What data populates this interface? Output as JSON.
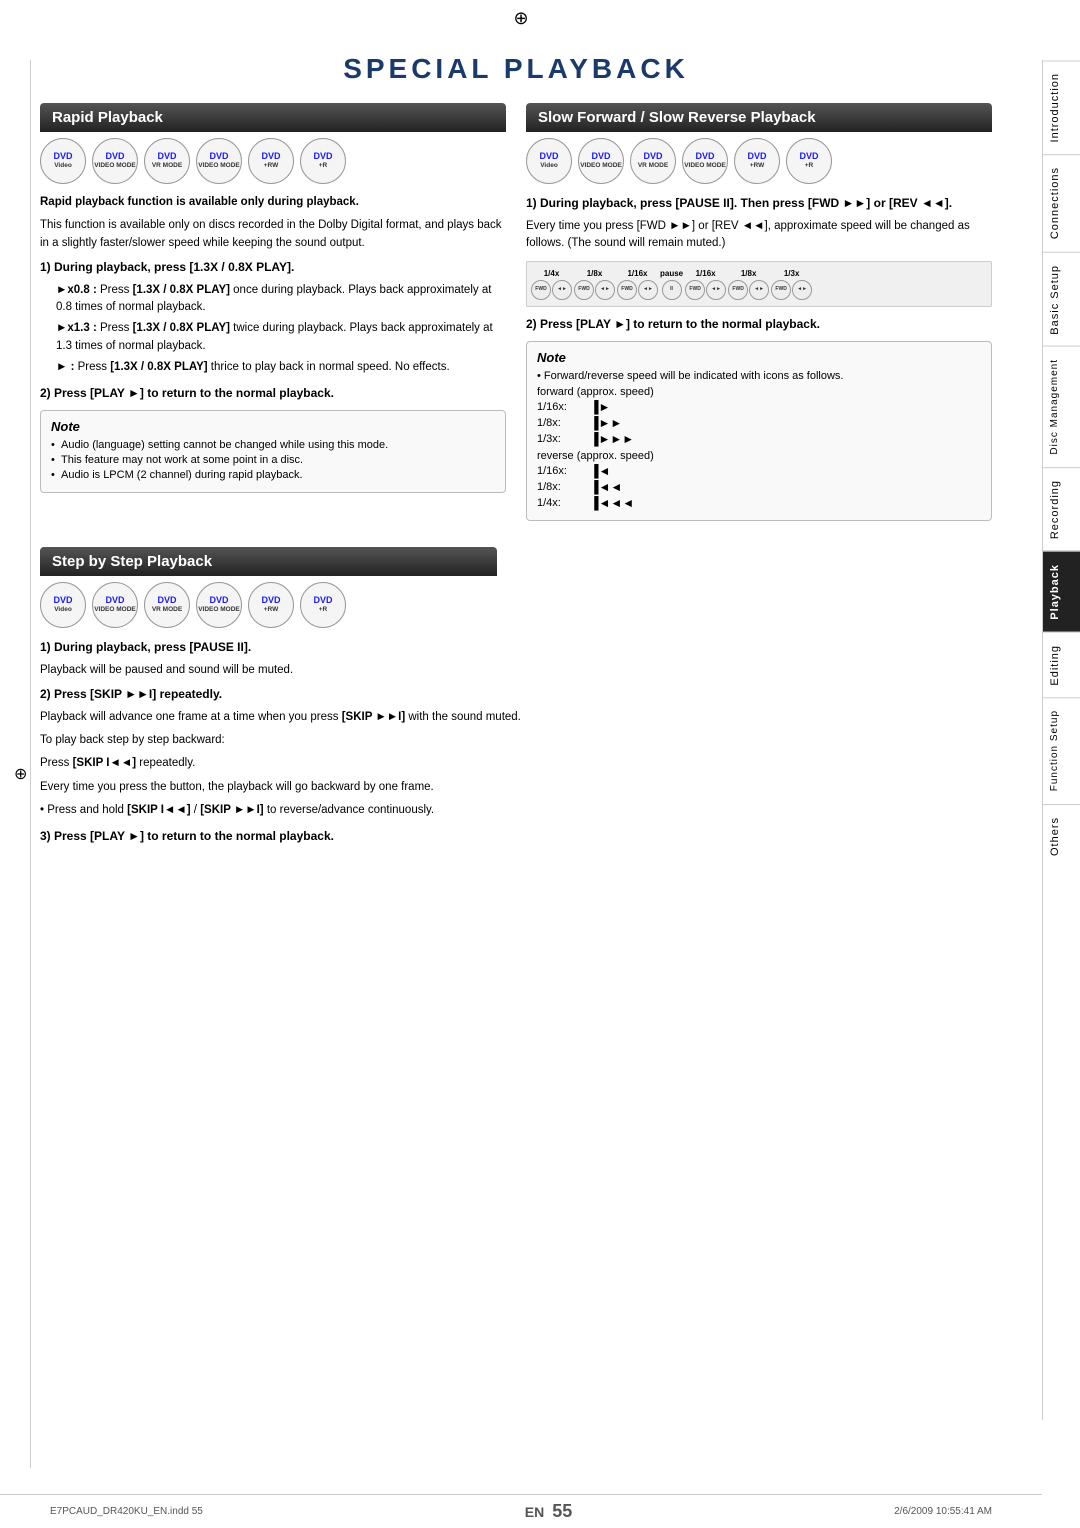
{
  "page": {
    "title": "SPECIAL PLAYBACK",
    "page_number": "55",
    "en_label": "EN",
    "file_info": "E7PCAUD_DR420KU_EN.indd  55",
    "date_info": "2/6/2009  10:55:41 AM"
  },
  "sidebar": {
    "tabs": [
      {
        "label": "Introduction",
        "active": false
      },
      {
        "label": "Connections",
        "active": false
      },
      {
        "label": "Basic Setup",
        "active": false
      },
      {
        "label": "Disc Management",
        "active": false
      },
      {
        "label": "Recording",
        "active": false
      },
      {
        "label": "Playback",
        "active": true
      },
      {
        "label": "Editing",
        "active": false
      },
      {
        "label": "Function Setup",
        "active": false
      },
      {
        "label": "Others",
        "active": false
      }
    ]
  },
  "rapid_playback": {
    "header": "Rapid Playback",
    "dvd_formats": [
      "DVD Video",
      "DVD VIDEO MODE",
      "DVD VR MODE",
      "DVD VIDEO MODE",
      "DVD +RW",
      "DVD +R"
    ],
    "intro_bold": "Rapid playback function is available only during playback.",
    "intro_text": "This function is available only on discs recorded in the Dolby Digital format, and plays back in a slightly faster/slower speed while keeping the sound output.",
    "step1_header": "1) During playback, press [1.3X / 0.8X PLAY].",
    "items": [
      {
        "symbol": "►x0.8 :",
        "text": "Press [1.3X / 0.8X PLAY] once during playback. Plays back approximately at 0.8 times of normal playback."
      },
      {
        "symbol": "►x1.3 :",
        "text": "Press [1.3X / 0.8X PLAY] twice during playback. Plays back approximately at 1.3 times of normal playback."
      },
      {
        "symbol": "► :",
        "text": "Press [1.3X / 0.8X PLAY] thrice to play back in normal speed. No effects."
      }
    ],
    "step2_header": "2) Press [PLAY ►] to return to the normal playback.",
    "note_title": "Note",
    "note_items": [
      "Audio (language) setting cannot be changed while using this mode.",
      "This feature may not work at some point in a disc.",
      "Audio is LPCM (2 channel) during rapid playback."
    ]
  },
  "slow_playback": {
    "header": "Slow Forward / Slow Reverse Playback",
    "dvd_formats": [
      "DVD Video",
      "DVD VIDEO MODE",
      "DVD VR MODE",
      "DVD VIDEO MODE",
      "DVD +RW",
      "DVD +R"
    ],
    "step1_header": "1) During playback, press [PAUSE II]. Then press [FWD ►►] or [REV ◄◄].",
    "step1_text": "Every time you press [FWD ►►] or [REV ◄◄], approximate speed will be changed as follows. (The sound will remain muted.)",
    "speed_diagram": {
      "steps": [
        "1/4x",
        "1/8x",
        "1/16x",
        "pause",
        "1/16x",
        "1/8x",
        "1/3x"
      ]
    },
    "step2_header": "2) Press [PLAY ►] to return to the normal playback.",
    "note_title": "Note",
    "note_intro": "• Forward/reverse speed will be indicated with icons as follows.",
    "forward_label": "forward (approx. speed)",
    "forward_speeds": [
      {
        "speed": "1/16x:",
        "icon": "▐►"
      },
      {
        "speed": "1/8x:",
        "icon": "▐►►"
      },
      {
        "speed": "1/3x:",
        "icon": "▐►►►"
      }
    ],
    "reverse_label": "reverse (approx. speed)",
    "reverse_speeds": [
      {
        "speed": "1/16x:",
        "icon": "▐◄"
      },
      {
        "speed": "1/8x:",
        "icon": "▐◄◄"
      },
      {
        "speed": "1/4x:",
        "icon": "▐◄◄◄"
      }
    ]
  },
  "step_by_step": {
    "header": "Step by Step Playback",
    "dvd_formats": [
      "DVD Video",
      "DVD VIDEO MODE",
      "DVD VR MODE",
      "DVD VIDEO MODE",
      "DVD +RW",
      "DVD +R"
    ],
    "step1_header": "1) During playback, press [PAUSE II].",
    "step1_text": "Playback will be paused and sound will be muted.",
    "step2_header": "2) Press [SKIP ►►I] repeatedly.",
    "step2_text1": "Playback will advance one frame at a time when you press [SKIP ►►I] with the sound muted.",
    "step2_text2": "To play back step by step backward:",
    "step2_text3": "Press [SKIP I◄◄] repeatedly.",
    "step2_text4": "Every time you press the button, the playback will go backward by one frame.",
    "step2_note": "• Press and hold [SKIP I◄◄] / [SKIP ►►I] to reverse/advance continuously.",
    "step3_header": "3) Press [PLAY ►] to return to the normal playback."
  }
}
